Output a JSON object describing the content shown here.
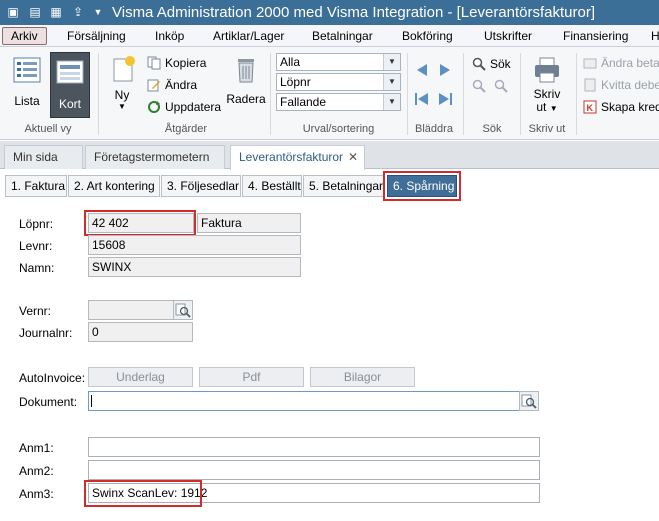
{
  "window": {
    "title": "Visma Administration 2000 med Visma Integration - [Leverantörsfakturor]"
  },
  "menu": [
    "Arkiv",
    "Försäljning",
    "Inköp",
    "Artiklar/Lager",
    "Betalningar",
    "Bokföring",
    "Utskrifter",
    "Finansiering",
    "H"
  ],
  "ribbon": {
    "view": {
      "lista": "Lista",
      "kort": "Kort",
      "group": "Aktuell vy"
    },
    "actions": {
      "ny": "Ny",
      "kopiera": "Kopiera",
      "andra": "Ändra",
      "uppdatera": "Uppdatera",
      "radera": "Radera",
      "group": "Åtgärder"
    },
    "sort": {
      "filter": "Alla",
      "order_by": "Löpnr",
      "direction": "Fallande",
      "group": "Urval/sortering"
    },
    "browse": {
      "group": "Bläddra"
    },
    "search": {
      "sok": "Sök",
      "group": "Sök"
    },
    "print": {
      "skriv": "Skriv",
      "ut": "ut",
      "group": "Skriv ut"
    },
    "extra": {
      "andra_beta": "Ändra beta",
      "kvitta": "Kvitta debe",
      "skapa": "Skapa kred"
    }
  },
  "doc_tabs": [
    "Min sida",
    "Företagstermometern",
    "Leverantörsfakturor"
  ],
  "close_glyph": "✕",
  "sub_tabs": [
    "1. Faktura",
    "2. Art kontering",
    "3. Följesedlar",
    "4. Beställt",
    "5. Betalningar",
    "6. Spårning"
  ],
  "form": {
    "lopnr_label": "Löpnr:",
    "lopnr": "42 402",
    "lopnr_type": "Faktura",
    "levnr_label": "Levnr:",
    "levnr": "15608",
    "namn_label": "Namn:",
    "namn": "SWINX",
    "vernr_label": "Vernr:",
    "vernr": "",
    "journalnr_label": "Journalnr:",
    "journalnr": "0",
    "autoinvoice_label": "AutoInvoice:",
    "underlag": "Underlag",
    "pdf": "Pdf",
    "bilagor": "Bilagor",
    "dokument_label": "Dokument:",
    "dokument": "",
    "anm1_label": "Anm1:",
    "anm1": "",
    "anm2_label": "Anm2:",
    "anm2": "",
    "anm3_label": "Anm3:",
    "anm3": "Swinx ScanLev: 1912"
  },
  "colors": {
    "titlebar": "#3c6f97",
    "active_tab": "#3f6e99",
    "highlight": "#d42a2a"
  }
}
